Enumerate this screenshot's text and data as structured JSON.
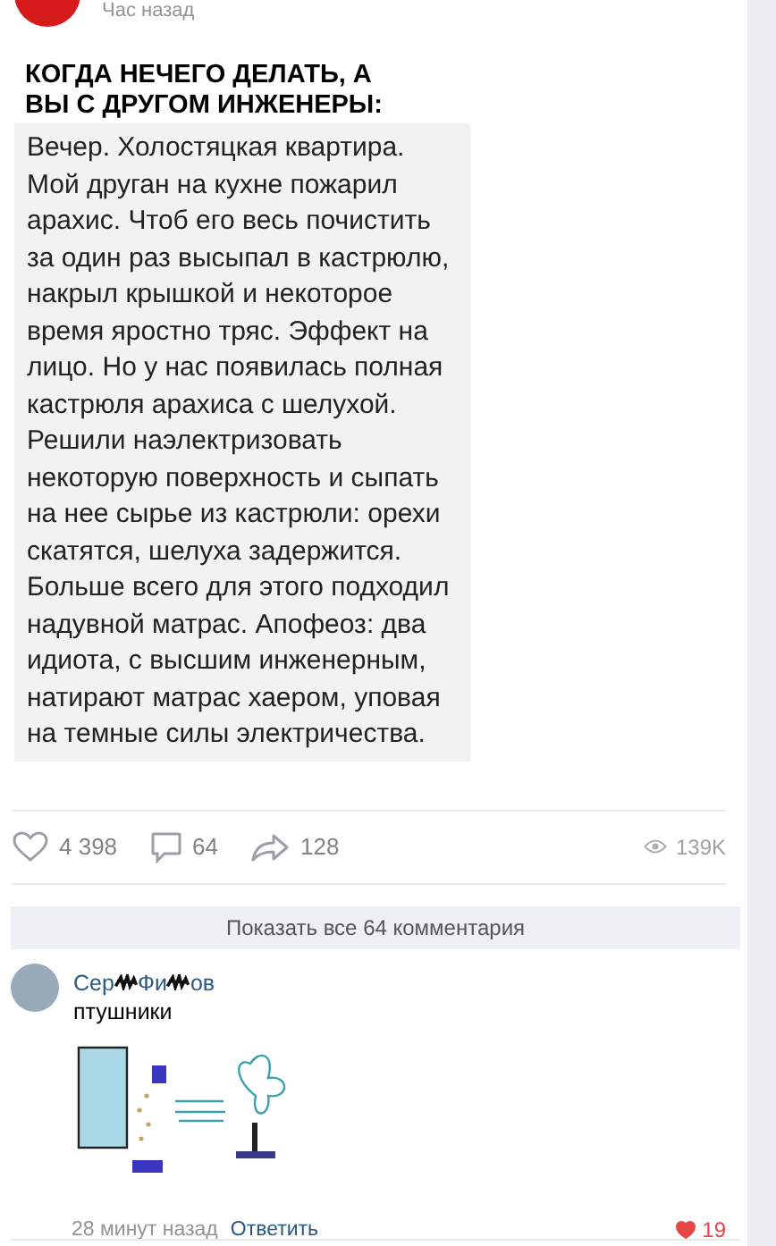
{
  "post": {
    "time": "Час назад",
    "title": "КОГДА НЕЧЕГО ДЕЛАТЬ, А ВЫ С ДРУГОМ ИНЖЕНЕРЫ:",
    "story": "Вечер. Холостяцкая квартира. Мой друган на кухне пожарил арахис. Чтоб его весь почистить за один раз высыпал в кастрюлю, накрыл крышкой и некоторое время яростно тряс. Эффект на лицо. Но у нас появилась полная кастрюля арахиса с шелухой. Решили наэлектризовать некоторую поверхность и сыпать на нее сырье из кастрюли: орехи скатятся, шелуха задержится. Больше всего для этого подходил надувной матрас. Апофеоз: два идиота, с высшим инженерным, натирают матрас хаером, уповая на темные силы электричества."
  },
  "actions": {
    "likes": "4 398",
    "comments": "64",
    "shares": "128",
    "views": "139K"
  },
  "show_comments": "Показать все 64 комментария",
  "comment": {
    "author_parts": [
      "Сер",
      "Фи",
      "ов"
    ],
    "text": "птушники",
    "time": "28 минут назад",
    "reply": "Ответить",
    "likes": "19",
    "liked": true
  }
}
